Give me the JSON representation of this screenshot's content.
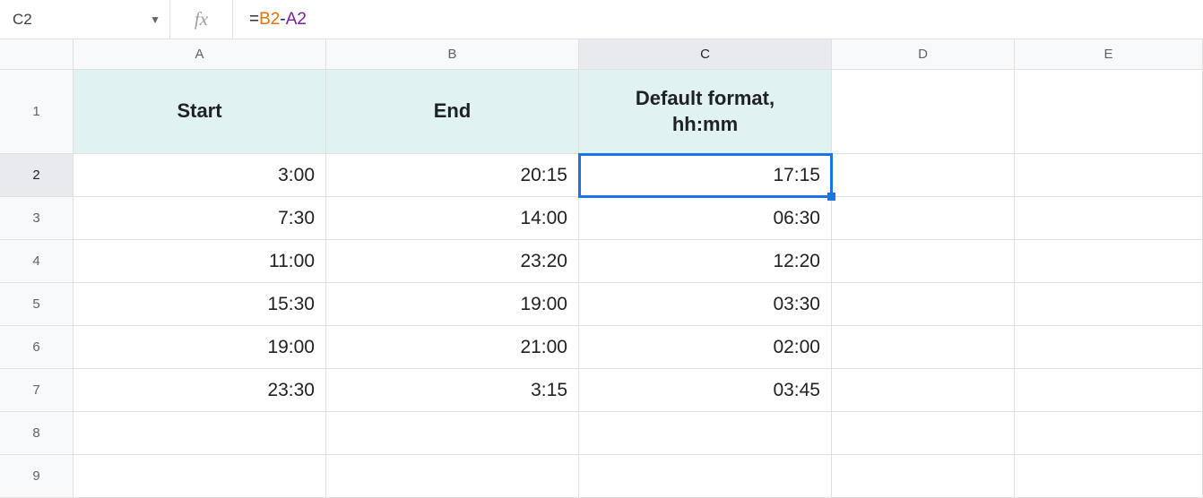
{
  "nameBox": {
    "value": "C2"
  },
  "fxLabel": "fx",
  "formula": {
    "eq": "=",
    "ref1": "B2",
    "op": "-",
    "ref2": "A2"
  },
  "columns": [
    "A",
    "B",
    "C",
    "D",
    "E"
  ],
  "activeColumn": "C",
  "activeRow": "2",
  "rowNumbers": [
    "1",
    "2",
    "3",
    "4",
    "5",
    "6",
    "7",
    "8",
    "9"
  ],
  "headers": {
    "A": "Start",
    "B": "End",
    "C": "Default format,\nhh:mm"
  },
  "rows": [
    {
      "A": "3:00",
      "B": "20:15",
      "C": "17:15"
    },
    {
      "A": "7:30",
      "B": "14:00",
      "C": "06:30"
    },
    {
      "A": "11:00",
      "B": "23:20",
      "C": "12:20"
    },
    {
      "A": "15:30",
      "B": "19:00",
      "C": "03:30"
    },
    {
      "A": "19:00",
      "B": "21:00",
      "C": "02:00"
    },
    {
      "A": "23:30",
      "B": "3:15",
      "C": "03:45"
    }
  ],
  "chart_data": {
    "type": "table",
    "title": "Time difference (Default format hh:mm)",
    "columns": [
      "Start",
      "End",
      "Default format, hh:mm"
    ],
    "rows": [
      [
        "3:00",
        "20:15",
        "17:15"
      ],
      [
        "7:30",
        "14:00",
        "06:30"
      ],
      [
        "11:00",
        "23:20",
        "12:20"
      ],
      [
        "15:30",
        "19:00",
        "03:30"
      ],
      [
        "19:00",
        "21:00",
        "02:00"
      ],
      [
        "23:30",
        "3:15",
        "03:45"
      ]
    ]
  }
}
